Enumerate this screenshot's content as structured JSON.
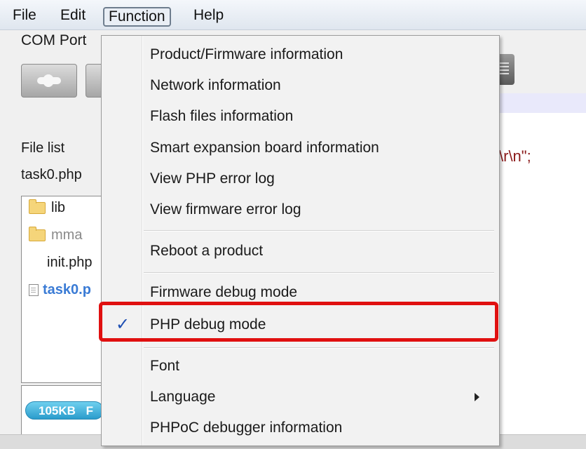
{
  "menubar": {
    "items": [
      "File",
      "Edit",
      "Function",
      "Help"
    ]
  },
  "window": {
    "com_port_label": "COM Port",
    "file_list_label": "File list",
    "current_file": "task0.php",
    "tree": [
      {
        "type": "folder",
        "label": "lib"
      },
      {
        "type": "folder",
        "label": "mma"
      },
      {
        "type": "file",
        "label": "init.php"
      },
      {
        "type": "file",
        "label": "task0.p"
      }
    ],
    "code_snippet": "\\r\\n\";",
    "memory_label": "105KB",
    "memory_suffix": "F"
  },
  "function_menu": {
    "items": [
      {
        "label": "Product/Firmware information"
      },
      {
        "label": "Network information"
      },
      {
        "label": "Flash files information"
      },
      {
        "label": "Smart expansion board information"
      },
      {
        "label": "View PHP error log"
      },
      {
        "label": "View firmware error log"
      },
      {
        "label": "Reboot a product"
      },
      {
        "label": "Firmware debug mode"
      },
      {
        "label": "PHP debug mode",
        "checked": true
      },
      {
        "label": "Font"
      },
      {
        "label": "Language",
        "submenu": true
      },
      {
        "label": "PHPoC debugger information"
      }
    ],
    "check_glyph": "✓"
  },
  "colors": {
    "highlight": "#e01010",
    "memory_pill": "#2b9ccc",
    "check": "#1e4fb3"
  }
}
